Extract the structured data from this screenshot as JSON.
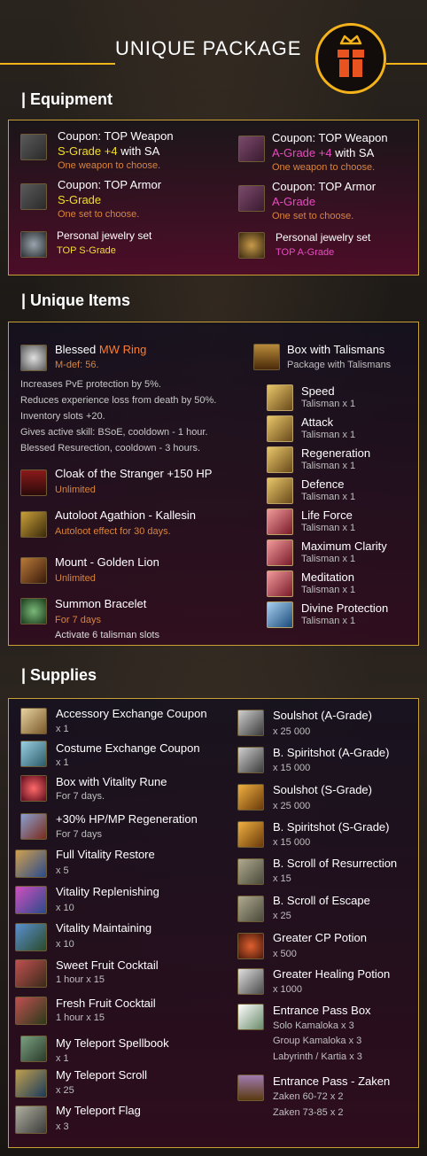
{
  "header": {
    "title": "UNIQUE PACKAGE",
    "icon": "gift-crown-icon"
  },
  "equipment": {
    "title": "| Equipment",
    "left": [
      {
        "l1": "Coupon: TOP Weapon",
        "grade": "S-Grade +4",
        "rest": " with SA",
        "sub": "One weapon to choose."
      },
      {
        "l1": "Coupon: TOP Armor",
        "grade": "S-Grade",
        "rest": "",
        "sub": "One set to choose."
      },
      {
        "l1": "Personal jewelry set",
        "sub": "TOP S-Grade"
      }
    ],
    "right": [
      {
        "l1": "Coupon: TOP Weapon",
        "grade": "A-Grade +4",
        "rest": " with SA",
        "sub": "One weapon to choose."
      },
      {
        "l1": "Coupon: TOP Armor",
        "grade": "A-Grade",
        "rest": "",
        "sub": "One set to choose."
      },
      {
        "l1": "Personal jewelry set",
        "sub": "TOP A-Grade"
      }
    ]
  },
  "unique": {
    "title": "| Unique Items",
    "ring": {
      "pre": "Blessed ",
      "name": "MW Ring",
      "sub": "M-def: 56.",
      "desc": [
        "Increases PvE protection by 5%.",
        "Reduces experience loss from death by 50%.",
        "Inventory slots +20.",
        "Gives active skill: BSoE, cooldown - 1 hour.",
        "Blessed Resurection, cooldown - 3 hours."
      ]
    },
    "left": [
      {
        "name": "Cloak of the Stranger +150 HP",
        "sub": "Unlimited"
      },
      {
        "name": "Autoloot Agathion - Kallesin",
        "sub": "Autoloot effect for 30 days."
      },
      {
        "name": "Mount - Golden Lion",
        "sub": "Unlimited"
      },
      {
        "name": "Summon Bracelet",
        "sub": "For 7 days",
        "sub2": "Activate 6 talisman slots"
      }
    ],
    "box": {
      "name": "Box with Talismans",
      "sub": "Package with Talismans"
    },
    "talismans": [
      {
        "name": "Speed",
        "sub": "Talisman x 1"
      },
      {
        "name": "Attack",
        "sub": "Talisman x 1"
      },
      {
        "name": "Regeneration",
        "sub": "Talisman x 1"
      },
      {
        "name": "Defence",
        "sub": "Talisman x 1"
      },
      {
        "name": "Life Force",
        "sub": "Talisman x 1"
      },
      {
        "name": "Maximum Clarity",
        "sub": "Talisman x 1"
      },
      {
        "name": "Meditation",
        "sub": "Talisman x 1"
      },
      {
        "name": "Divine Protection",
        "sub": "Talisman x 1"
      }
    ]
  },
  "supplies": {
    "title": "| Supplies",
    "left": [
      {
        "name": "Accessory Exchange Coupon",
        "sub": "x 1"
      },
      {
        "name": "Costume Exchange Coupon",
        "sub": "x 1"
      },
      {
        "name": "Box with Vitality Rune",
        "sub": "For 7 days."
      },
      {
        "name": "+30% HP/MP Regeneration",
        "sub": "For 7 days"
      },
      {
        "name": "Full Vitality Restore",
        "sub": "x 5"
      },
      {
        "name": "Vitality Replenishing",
        "sub": "x 10"
      },
      {
        "name": "Vitality Maintaining",
        "sub": "x 10"
      },
      {
        "name": "Sweet Fruit Cocktail",
        "sub": "1 hour x 15"
      },
      {
        "name": "Fresh Fruit Cocktail",
        "sub": "1 hour x 15"
      },
      {
        "name": "My Teleport Spellbook",
        "sub": "x 1"
      },
      {
        "name": "My Teleport Scroll",
        "sub": "x 25"
      },
      {
        "name": "My Teleport Flag",
        "sub": "x 3"
      }
    ],
    "right": [
      {
        "name": "Soulshot (A-Grade)",
        "sub": "x 25 000"
      },
      {
        "name": "B. Spiritshot (A-Grade)",
        "sub": "x 15 000"
      },
      {
        "name": "Soulshot (S-Grade)",
        "sub": "x 25 000"
      },
      {
        "name": "B. Spiritshot (S-Grade)",
        "sub": "x 15 000"
      },
      {
        "name": "B. Scroll of Resurrection",
        "sub": "x 15"
      },
      {
        "name": "B. Scroll of Escape",
        "sub": "x 25"
      },
      {
        "name": "Greater CP Potion",
        "sub": "x 500"
      },
      {
        "name": "Greater Healing Potion",
        "sub": "x 1000"
      },
      {
        "name": "Entrance Pass Box",
        "sub": "Solo Kamaloka x 3",
        "sub2": "Group Kamaloka x 3",
        "sub3": "Labyrinth / Kartia x 3"
      },
      {
        "name": "Entrance Pass - Zaken",
        "sub": "Zaken 60-72 x 2",
        "sub2": "Zaken 73-85 x 2"
      }
    ]
  }
}
